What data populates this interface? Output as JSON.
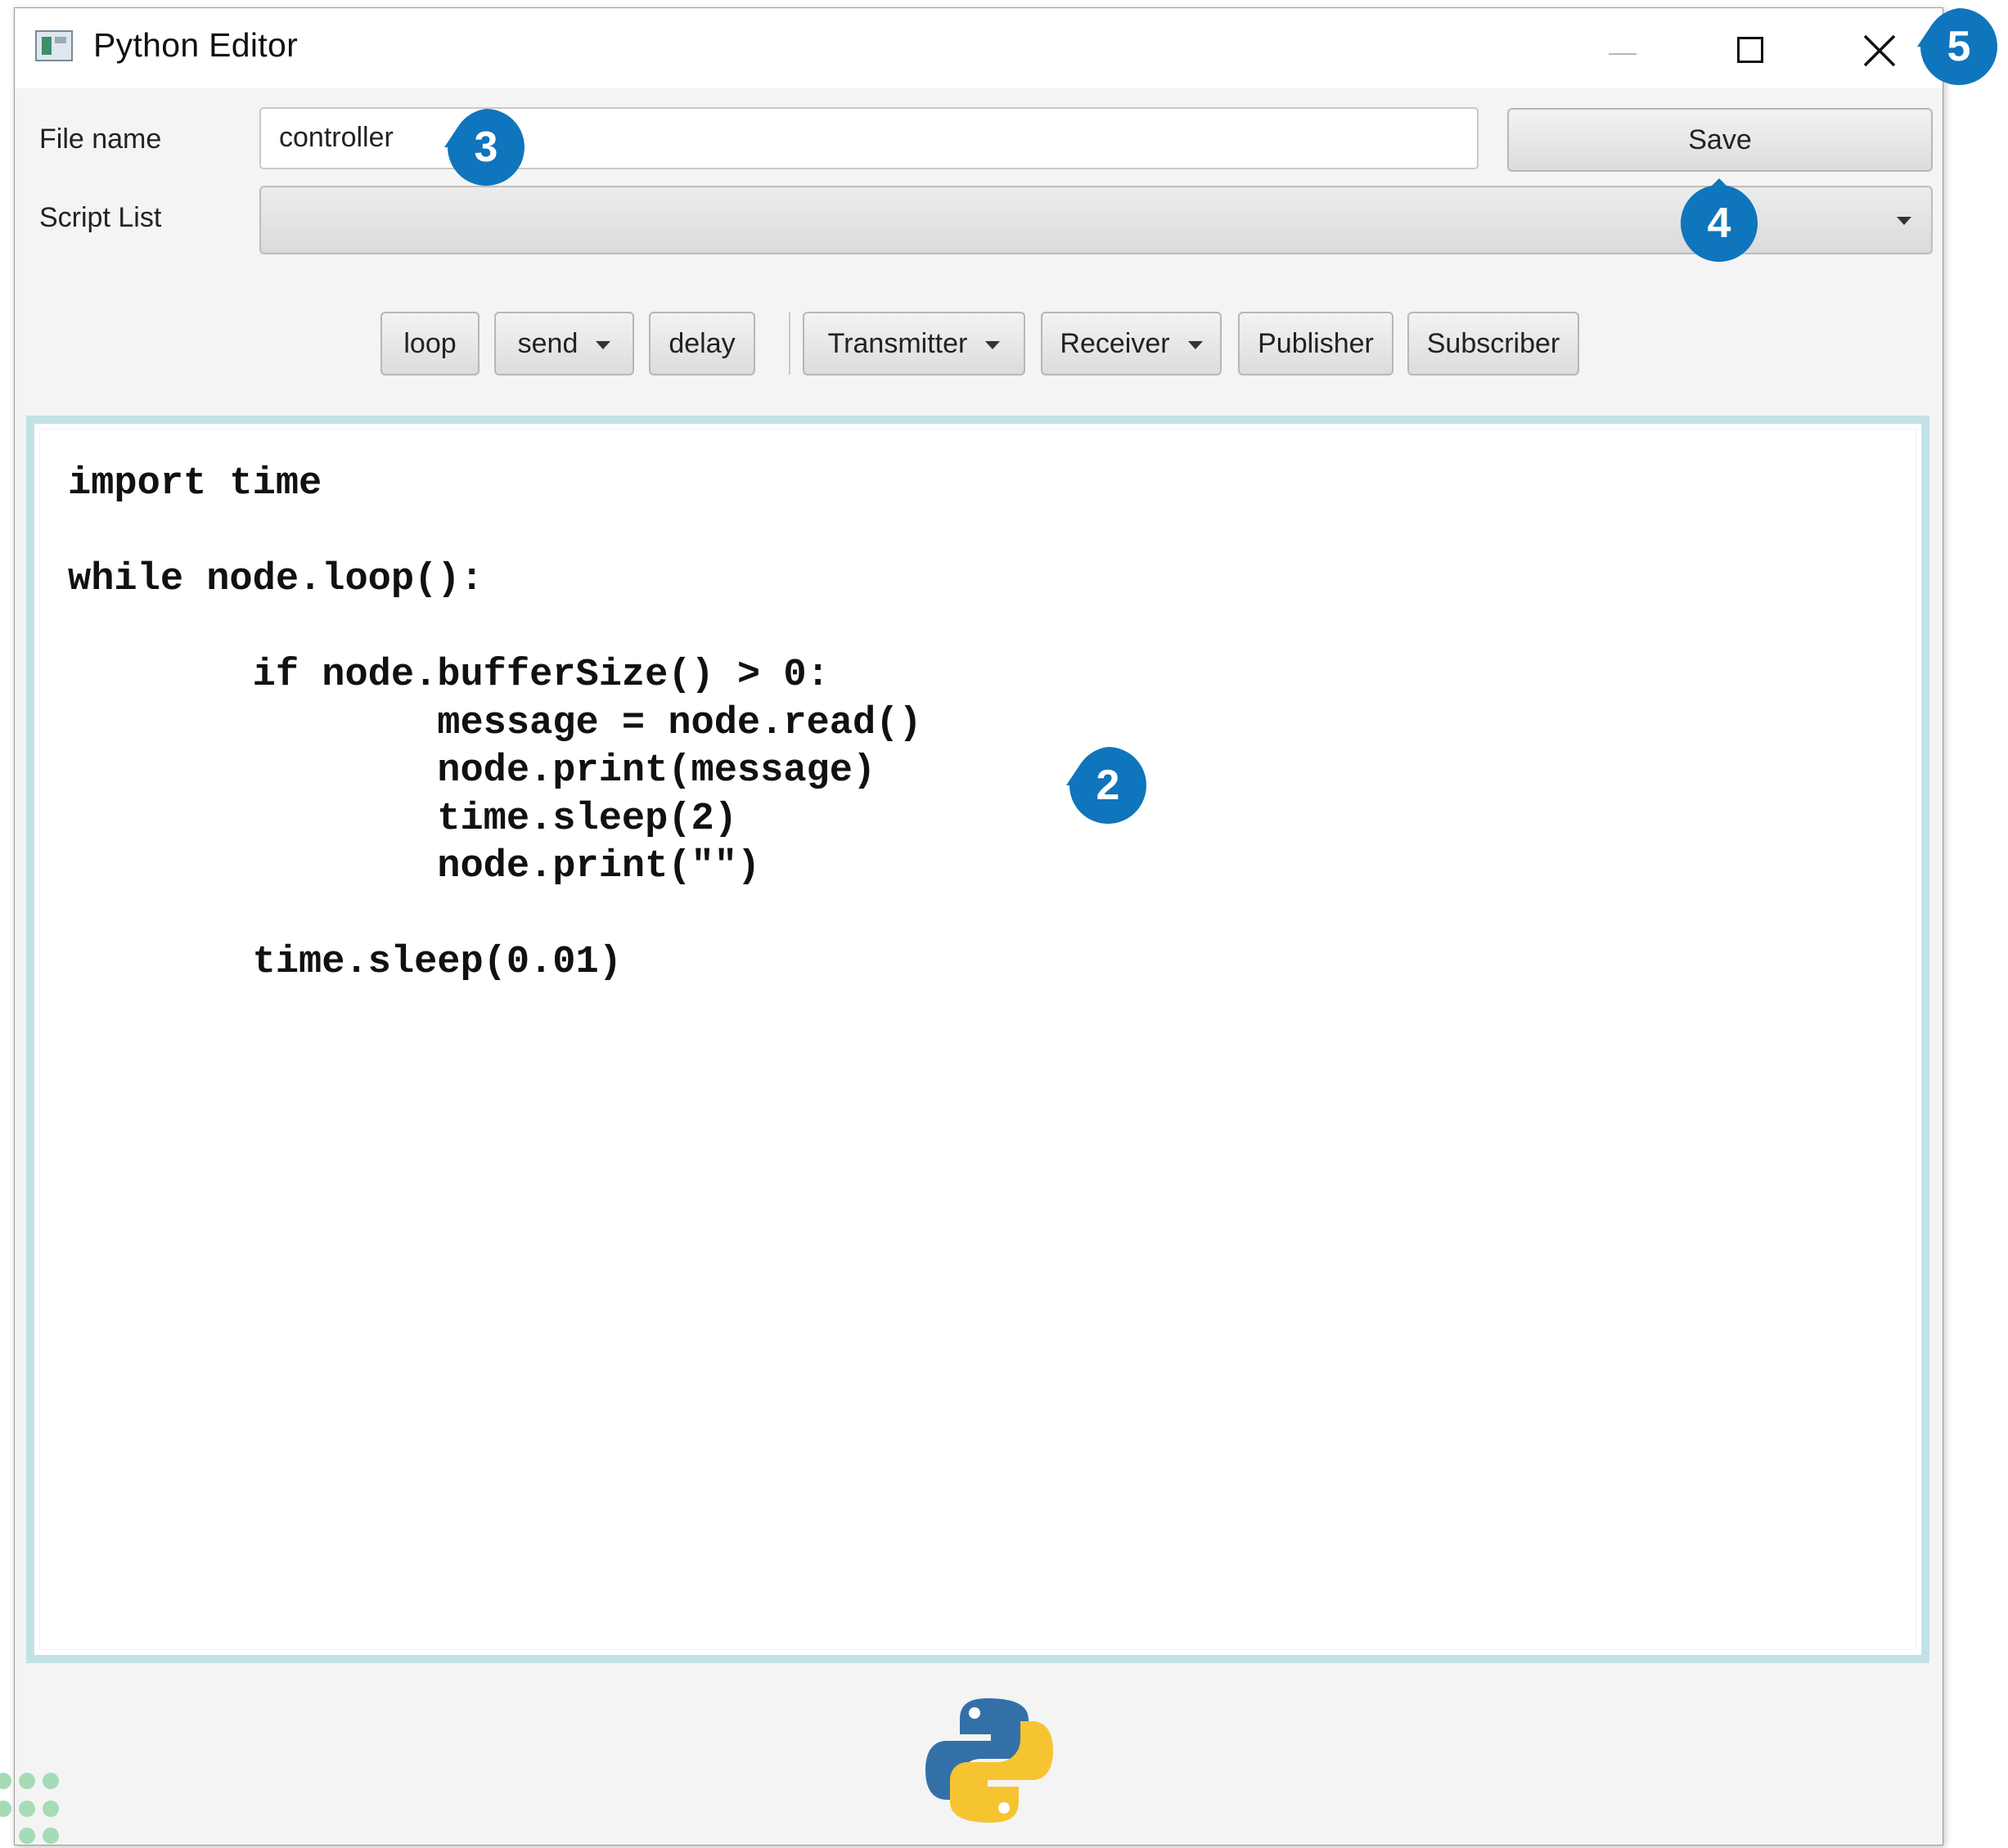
{
  "window": {
    "title": "Python Editor",
    "icons": {
      "app": "app-window-icon",
      "minimize": "minimize-icon",
      "maximize": "maximize-icon",
      "close": "close-icon"
    }
  },
  "form": {
    "file_name_label": "File name",
    "file_name_value": "controller",
    "save_label": "Save",
    "script_list_label": "Script List",
    "script_list_value": ""
  },
  "toolbar": {
    "buttons": [
      {
        "label": "loop",
        "dropdown": false
      },
      {
        "label": "send",
        "dropdown": true
      },
      {
        "label": "delay",
        "dropdown": false
      },
      {
        "label": "Transmitter",
        "dropdown": true
      },
      {
        "label": "Receiver",
        "dropdown": true
      },
      {
        "label": "Publisher",
        "dropdown": false
      },
      {
        "label": "Subscriber",
        "dropdown": false
      }
    ]
  },
  "editor": {
    "code": "import time\n\nwhile node.loop():\n\n        if node.bufferSize() > 0:\n                message = node.read()\n                node.print(message)\n                time.sleep(2)\n                node.print(\"\")\n\n        time.sleep(0.01)"
  },
  "callouts": {
    "editor": "2",
    "file_name": "3",
    "save": "4",
    "close": "5",
    "color": "#0f75bc"
  },
  "footer": {
    "logo": "python-logo-icon"
  }
}
